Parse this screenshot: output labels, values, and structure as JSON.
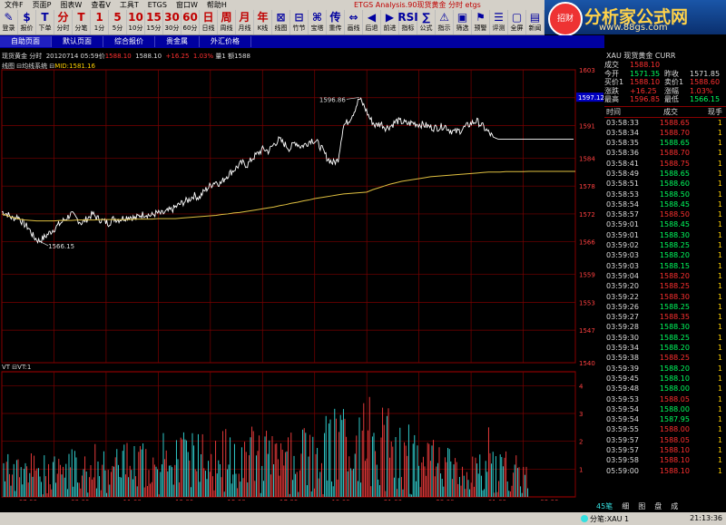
{
  "menu": {
    "items": [
      "文件F",
      "页面P",
      "图表W",
      "查看V",
      "工具T",
      "ETGS",
      "窗口W",
      "帮助H"
    ],
    "title": "ETGS Analysis.90现货黄金 分时 etgs"
  },
  "toolbar": [
    {
      "icon": "✎",
      "label": "登录"
    },
    {
      "icon": "$",
      "label": "报价"
    },
    {
      "icon": "T",
      "label": "下单"
    },
    {
      "icon": "分",
      "label": "分时"
    },
    {
      "icon": "T",
      "label": "分笔"
    },
    {
      "icon": "1",
      "label": "1分"
    },
    {
      "icon": "5",
      "label": "5分"
    },
    {
      "icon": "10",
      "label": "10分"
    },
    {
      "icon": "15",
      "label": "15分"
    },
    {
      "icon": "30",
      "label": "30分"
    },
    {
      "icon": "60",
      "label": "60分"
    },
    {
      "icon": "日",
      "label": "日线"
    },
    {
      "icon": "周",
      "label": "周线"
    },
    {
      "icon": "月",
      "label": "月线"
    },
    {
      "icon": "年",
      "label": "K线"
    },
    {
      "icon": "⊠",
      "label": "线图"
    },
    {
      "icon": "⊟",
      "label": "竹节"
    },
    {
      "icon": "⌘",
      "label": "宝塔"
    },
    {
      "icon": "传",
      "label": "重传"
    },
    {
      "icon": "⇔",
      "label": "画线"
    },
    {
      "icon": "◀",
      "label": "后退"
    },
    {
      "icon": "▶",
      "label": "前进"
    },
    {
      "icon": "RSI",
      "label": "指标"
    },
    {
      "icon": "∑",
      "label": "公式"
    },
    {
      "icon": "⚠",
      "label": "指示"
    },
    {
      "icon": "▣",
      "label": "筛选"
    },
    {
      "icon": "⚑",
      "label": "预警"
    },
    {
      "icon": "☰",
      "label": "评测"
    },
    {
      "icon": "▢",
      "label": "全屏"
    },
    {
      "icon": "▤",
      "label": "新闻"
    }
  ],
  "logo": {
    "title": "分析家公式网",
    "url": "www.88gs.com",
    "emblem": "招财"
  },
  "tabs": [
    "自助页面",
    "默认页面",
    "综合报价",
    "贵金属",
    "外汇价格"
  ],
  "info": {
    "symbol": "现货黄金 分时",
    "date": "20120714 05:59",
    "price_label": "价",
    "price": "1588.10",
    "value2": "1588.10",
    "change": "+16.25",
    "pct": "1.03%",
    "vol_label": "量1",
    "amt_label": "额1588"
  },
  "ma_legend": {
    "chart": "线图",
    "name": "均线系统",
    "mid": "MID:1581.16"
  },
  "vt_legend": {
    "name": "VT",
    "value": "VT:1"
  },
  "price_labels": {
    "high": "1596.86",
    "low": "1566.15"
  },
  "current_price_tag": "1597.12",
  "price_axis": [
    "1603",
    "1597",
    "1591",
    "1584",
    "1578",
    "1572",
    "1566",
    "1559",
    "1553",
    "1547",
    "1540"
  ],
  "volume_axis": [
    "4",
    "3",
    "2",
    "1"
  ],
  "time_axis": [
    "07:00",
    "09:00",
    "11:00",
    "13:00",
    "15:00",
    "17:00",
    "19:00",
    "21:00",
    "23:00",
    "01:00",
    "03:00"
  ],
  "quote": {
    "header": "XAU 现货黄金 CURR",
    "rows": [
      {
        "k1": "成交",
        "v1": "1588.10",
        "k2": "",
        "v2": ""
      },
      {
        "k1": "今开",
        "v1": "1571.35",
        "k2": "昨收",
        "v2": "1571.85"
      },
      {
        "k1": "买价1",
        "v1": "1588.10",
        "k2": "卖价1",
        "v2": "1588.60"
      },
      {
        "k1": "涨跌",
        "v1": "+16.25",
        "k2": "涨幅",
        "v2": "1.03%"
      },
      {
        "k1": "最高",
        "v1": "1596.85",
        "k2": "最低",
        "v2": "1566.15"
      }
    ]
  },
  "ticks_header": {
    "time": "时间",
    "price": "成交",
    "vol": "现手"
  },
  "ticks": [
    [
      "03:58:33",
      "1588.65",
      "1"
    ],
    [
      "03:58:34",
      "1588.70",
      "1"
    ],
    [
      "03:58:35",
      "1588.65",
      "1"
    ],
    [
      "03:58:36",
      "1588.70",
      "1"
    ],
    [
      "03:58:41",
      "1588.75",
      "1"
    ],
    [
      "03:58:49",
      "1588.65",
      "1"
    ],
    [
      "03:58:51",
      "1588.60",
      "1"
    ],
    [
      "03:58:53",
      "1588.50",
      "1"
    ],
    [
      "03:58:54",
      "1588.45",
      "1"
    ],
    [
      "03:58:57",
      "1588.50",
      "1"
    ],
    [
      "03:59:01",
      "1588.45",
      "1"
    ],
    [
      "03:59:01",
      "1588.30",
      "1"
    ],
    [
      "03:59:02",
      "1588.25",
      "1"
    ],
    [
      "03:59:03",
      "1588.20",
      "1"
    ],
    [
      "03:59:03",
      "1588.15",
      "1"
    ],
    [
      "03:59:04",
      "1588.20",
      "1"
    ],
    [
      "03:59:20",
      "1588.25",
      "1"
    ],
    [
      "03:59:22",
      "1588.30",
      "1"
    ],
    [
      "03:59:26",
      "1588.25",
      "1"
    ],
    [
      "03:59:27",
      "1588.35",
      "1"
    ],
    [
      "03:59:28",
      "1588.30",
      "1"
    ],
    [
      "03:59:30",
      "1588.25",
      "1"
    ],
    [
      "03:59:34",
      "1588.20",
      "1"
    ],
    [
      "03:59:38",
      "1588.25",
      "1"
    ],
    [
      "03:59:39",
      "1588.20",
      "1"
    ],
    [
      "03:59:45",
      "1588.10",
      "1"
    ],
    [
      "03:59:48",
      "1588.00",
      "1"
    ],
    [
      "03:59:53",
      "1588.05",
      "1"
    ],
    [
      "03:59:54",
      "1588.00",
      "1"
    ],
    [
      "03:59:54",
      "1587.95",
      "1"
    ],
    [
      "03:59:55",
      "1588.00",
      "1"
    ],
    [
      "03:59:57",
      "1588.05",
      "1"
    ],
    [
      "03:59:57",
      "1588.10",
      "1"
    ],
    [
      "03:59:58",
      "1588.10",
      "1"
    ],
    [
      "05:59:00",
      "1588.10",
      "1"
    ]
  ],
  "bottom_tabs": [
    "45笔",
    "细",
    "图",
    "盘",
    "成"
  ],
  "status": {
    "left": "分笔:XAU 1",
    "clock": "21:13:36"
  },
  "colors": {
    "up": "#ff3030",
    "down": "#00ff60",
    "price": "#ffffff",
    "ma": "#e0c040",
    "grid": "#7a0000",
    "vol_up": "#ff4040",
    "vol_down": "#35e0e0"
  },
  "chart_data": {
    "type": "line",
    "title": "",
    "ylim": [
      1540,
      1603
    ],
    "price_series": [
      1572.5,
      1572,
      1571,
      1571.5,
      1570,
      1569,
      1567,
      1566.15,
      1567,
      1568,
      1569,
      1570,
      1571,
      1572,
      1571,
      1570,
      1571,
      1572,
      1571,
      1570.5,
      1570,
      1571,
      1570.8,
      1571.2,
      1571.5,
      1571,
      1571.8,
      1572,
      1571.6,
      1572.2,
      1572,
      1572.5,
      1573,
      1573.8,
      1574.5,
      1575,
      1576,
      1575.5,
      1577,
      1578,
      1579,
      1578.5,
      1580,
      1581,
      1582,
      1583,
      1582.5,
      1584,
      1585,
      1586,
      1585.5,
      1587,
      1588,
      1587,
      1586,
      1587.5,
      1586.5,
      1587,
      1588,
      1587.5,
      1586,
      1584,
      1583,
      1583.5,
      1591,
      1592,
      1594,
      1596.86,
      1595,
      1592.5,
      1591,
      1591.5,
      1590.5,
      1591,
      1592,
      1591.8,
      1591.4,
      1591.6,
      1591.3,
      1591.2,
      1590.8,
      1590.5,
      1590.6,
      1591,
      1590,
      1589.6,
      1590,
      1590.8,
      1591.5,
      1592,
      1591,
      1589.8,
      1588.6,
      1588.1,
      1588.1,
      1588.1,
      1588.1,
      1588.1,
      1588.1,
      1588.1
    ],
    "ma_series": [
      1572,
      1571.6,
      1571.2,
      1570.9,
      1570.7,
      1570.6,
      1570.5,
      1570.5,
      1570.5,
      1570.5,
      1570.6,
      1570.6,
      1570.6,
      1570.7,
      1570.7,
      1570.7,
      1570.7,
      1570.8,
      1570.8,
      1570.8,
      1570.8,
      1570.8,
      1570.8,
      1570.9,
      1570.9,
      1570.9,
      1570.9,
      1571,
      1571,
      1571,
      1571,
      1571.1,
      1571.2,
      1571.3,
      1571.4,
      1571.5,
      1571.6,
      1571.7,
      1571.9,
      1572,
      1572.2,
      1572.3,
      1572.5,
      1572.7,
      1572.9,
      1573.1,
      1573.3,
      1573.5,
      1573.8,
      1574,
      1574.3,
      1574.5,
      1574.8,
      1575,
      1575.3,
      1575.5,
      1575.7,
      1575.9,
      1576.1,
      1576.3,
      1576.4,
      1576.5,
      1576.6,
      1576.7,
      1577.2,
      1577.6,
      1578,
      1578.4,
      1578.7,
      1579,
      1579.2,
      1579.4,
      1579.6,
      1579.8,
      1580,
      1580.1,
      1580.2,
      1580.3,
      1580.4,
      1580.5,
      1580.6,
      1580.7,
      1580.8,
      1580.9,
      1581,
      1581,
      1581,
      1581.1,
      1581.1,
      1581.1,
      1581.1,
      1581.15,
      1581.16,
      1581.16,
      1581.16,
      1581.16,
      1581.16,
      1581.16,
      1581.16,
      1581.16
    ],
    "volume_ylim": [
      0,
      4.5
    ],
    "volume_note": "intraday tick volume bars, red/cyan, heavier during 19:00-21:00"
  }
}
